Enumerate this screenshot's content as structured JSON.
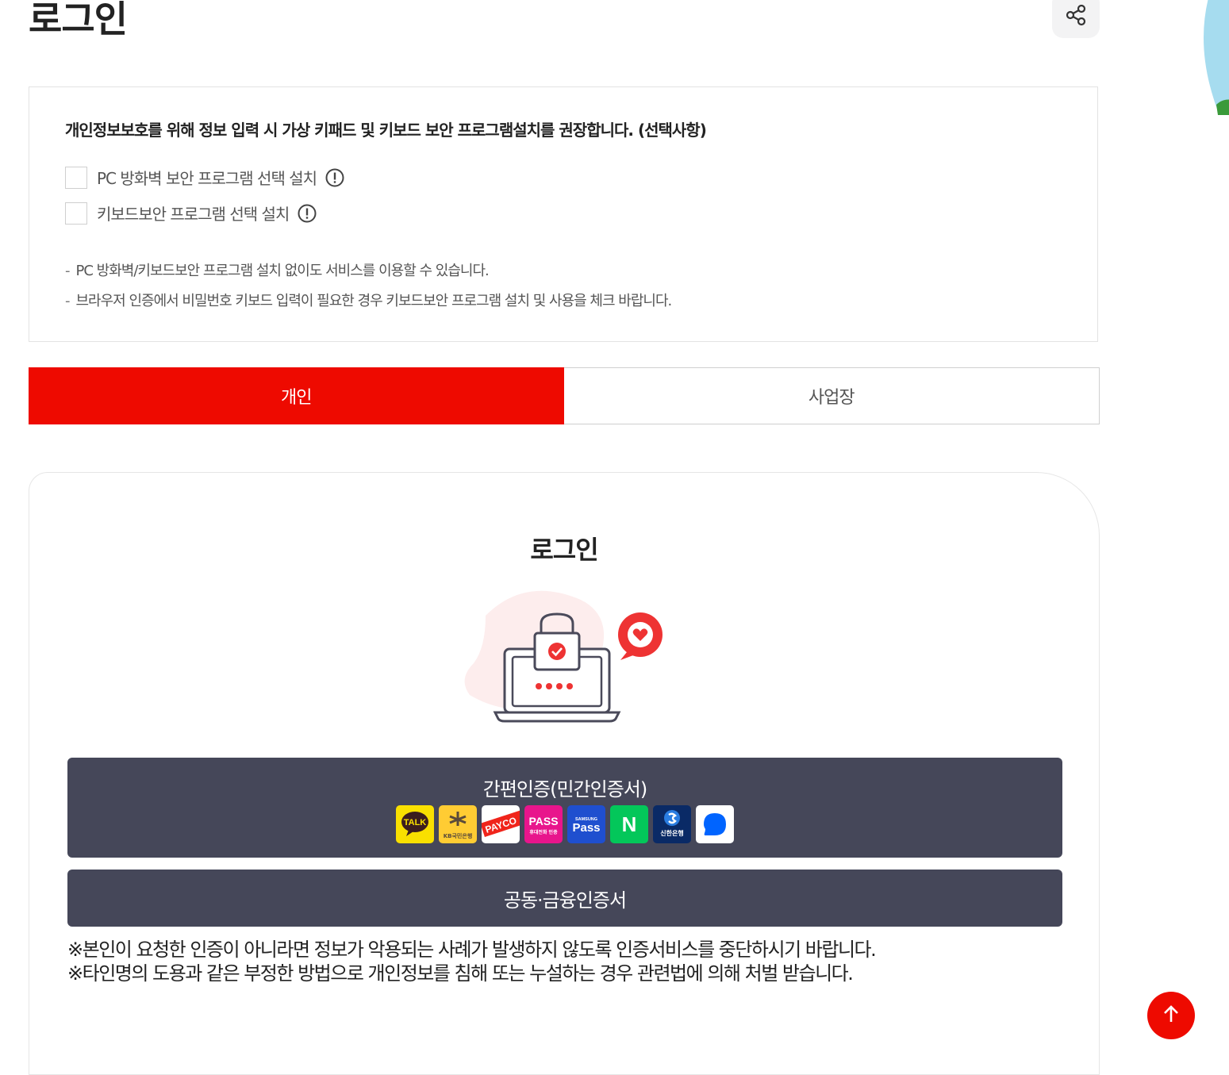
{
  "header": {
    "title": "로그인"
  },
  "notice": {
    "heading": "개인정보보호를 위해 정보 입력 시 가상 키패드 및 키보드 보안 프로그램설치를 권장합니다. (선택사항)",
    "options": [
      {
        "label": "PC 방화벽 보안 프로그램 선택 설치",
        "checked": false
      },
      {
        "label": "키보드보안 프로그램 선택 설치",
        "checked": false
      }
    ],
    "notes": [
      "PC 방화벽/키보드보안 프로그램 설치 없이도 서비스를 이용할 수 있습니다.",
      "브라우저 인증에서 비밀번호 키보드 입력이 필요한 경우 키보드보안 프로그램 설치 및 사용을 체크 바랍니다."
    ],
    "note_bullet": "-"
  },
  "tabs": [
    {
      "label": "개인",
      "active": true
    },
    {
      "label": "사업장",
      "active": false
    }
  ],
  "login": {
    "title": "로그인",
    "easy_auth_label": "간편인증(민간인증서)",
    "providers": [
      {
        "name": "kakao-talk",
        "text": "TALK"
      },
      {
        "name": "kb",
        "text": "KB국민은행"
      },
      {
        "name": "payco",
        "text": "PAYCO"
      },
      {
        "name": "pass",
        "text": "PASS",
        "subtext": "휴대전화 인증"
      },
      {
        "name": "samsung-pass",
        "text": "Pass",
        "subtext": "SAMSUNG"
      },
      {
        "name": "naver",
        "text": "N"
      },
      {
        "name": "shinhan",
        "text": "신한은행"
      },
      {
        "name": "toss",
        "text": ""
      }
    ],
    "cert_label": "공동·금융인증서",
    "warnings": [
      "※본인이 요청한 인증이 아니라면 정보가 악용되는 사례가 발생하지 않도록 인증서비스를 중단하시기 바랍니다.",
      "※타인명의 도용과 같은 부정한 방법으로 개인정보를 침해 또는 누설하는 경우 관련법에 의해 처벌 받습니다."
    ]
  },
  "colors": {
    "accent": "#ee0a00",
    "button_dark": "#454759"
  }
}
